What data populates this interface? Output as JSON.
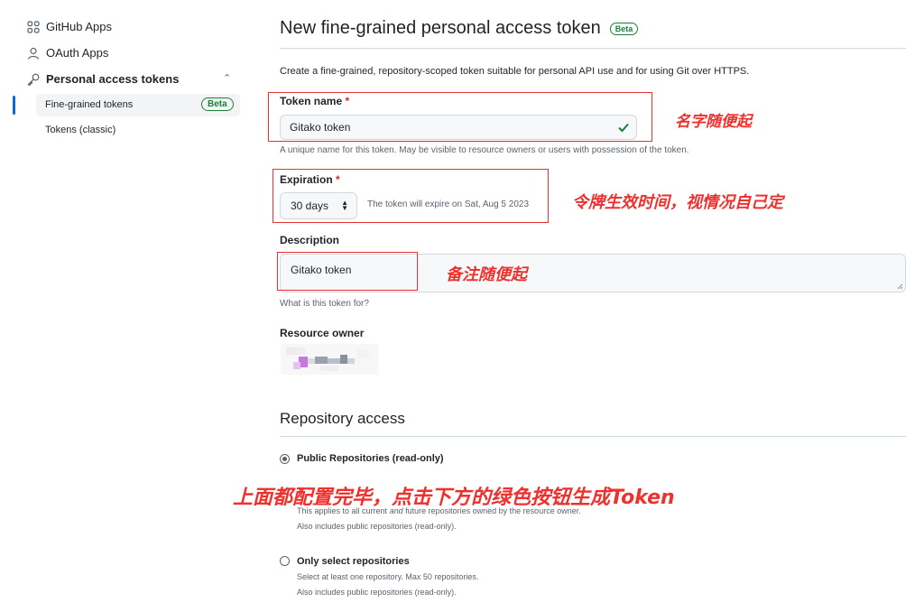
{
  "sidebar": {
    "github_apps": "GitHub Apps",
    "oauth_apps": "OAuth Apps",
    "personal_access_tokens": "Personal access tokens",
    "fine_grained": "Fine-grained tokens",
    "fine_grained_badge": "Beta",
    "classic": "Tokens (classic)"
  },
  "header": {
    "title": "New fine-grained personal access token",
    "badge": "Beta",
    "intro": "Create a fine-grained, repository-scoped token suitable for personal API use and for using Git over HTTPS."
  },
  "token_name": {
    "label": "Token name",
    "required_mark": "*",
    "value": "Gitako token",
    "note": "A unique name for this token. May be visible to resource owners or users with possession of the token."
  },
  "expiration": {
    "label": "Expiration",
    "required_mark": "*",
    "selected": "30 days",
    "note": "The token will expire on Sat, Aug 5 2023"
  },
  "description": {
    "label": "Description",
    "value": "Gitako token",
    "note": "What is this token for?"
  },
  "resource_owner": {
    "label": "Resource owner"
  },
  "repository_access": {
    "title": "Repository access",
    "options": [
      {
        "label": "Public Repositories (read-only)",
        "checked": true,
        "desc_line1_before": "This applies to all current",
        "desc_line1_italic": "and",
        "desc_line1_after": "future repositories owned by the resource owner.",
        "desc_line2": "Also includes public repositories (read-only)."
      },
      {
        "label": "Only select repositories",
        "checked": false,
        "desc_line1": "Select at least one repository. Max 50 repositories.",
        "desc_line2": "Also includes public repositories (read-only)."
      }
    ]
  },
  "annotations": {
    "name": "名字随便起",
    "expiration": "令牌生效时间，视情况自己定",
    "description": "备注随便起",
    "generate": "上面都配置完毕，点击下方的绿色按钮生成Token"
  },
  "colors": {
    "annotation_red": "#f0302c",
    "accent_blue": "#0969da",
    "success_green": "#1a7f37"
  }
}
